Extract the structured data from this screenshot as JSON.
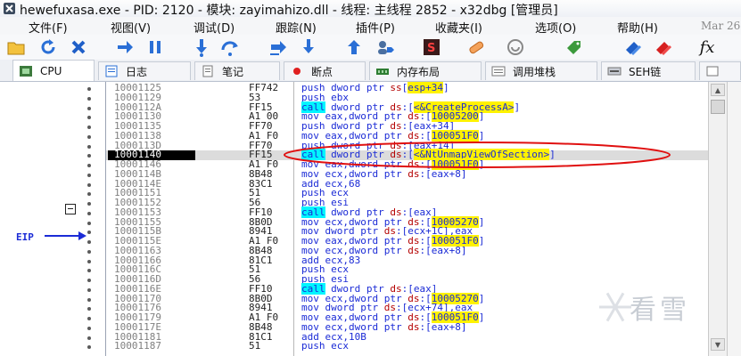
{
  "window": {
    "title": "hewefuxasa.exe - PID: 2120 - 模块: zayimahizo.dll - 线程: 主线程 2852 - x32dbg [管理员]"
  },
  "menu": [
    {
      "label": "文件(F)"
    },
    {
      "label": "视图(V)"
    },
    {
      "label": "调试(D)"
    },
    {
      "label": "跟踪(N)"
    },
    {
      "label": "插件(P)"
    },
    {
      "label": "收藏夹(I)"
    },
    {
      "label": "选项(O)"
    },
    {
      "label": "帮助(H)"
    }
  ],
  "menu_date": "Mar 26",
  "toolbar": [
    {
      "icon": "open-folder-icon"
    },
    {
      "icon": "restart-icon"
    },
    {
      "icon": "close-icon"
    },
    {
      "icon": "run-icon"
    },
    {
      "icon": "pause-icon"
    },
    {
      "icon": "step-into-icon"
    },
    {
      "icon": "step-over-icon"
    },
    {
      "icon": "trace-into-icon"
    },
    {
      "icon": "trace-over-icon"
    },
    {
      "icon": "execute-till-return-icon"
    },
    {
      "icon": "run-to-user-code-icon"
    },
    {
      "icon": "scylla-icon"
    },
    {
      "icon": "patch-icon"
    },
    {
      "icon": "comments-icon"
    },
    {
      "icon": "labels-icon"
    },
    {
      "icon": "bookmarks-icon"
    },
    {
      "icon": "functions-icon"
    }
  ],
  "toolbar_fx": "fx",
  "tabs": [
    {
      "label": "CPU",
      "active": true
    },
    {
      "label": "日志"
    },
    {
      "label": "笔记"
    },
    {
      "label": "断点"
    },
    {
      "label": "内存布局"
    },
    {
      "label": "调用堆栈"
    },
    {
      "label": "SEH链"
    }
  ],
  "eip_label": "EIP",
  "disasm": [
    {
      "addr": "10001125",
      "bytes": "FF742",
      "mn": "push",
      "op": [
        [
          "dword ptr ",
          ""
        ],
        [
          "ss",
          ":seg"
        ],
        [
          "[",
          ""
        ],
        [
          "esp+34",
          "hl"
        ],
        [
          "]",
          ""
        ]
      ]
    },
    {
      "addr": "10001129",
      "bytes": "53",
      "mn": "push",
      "op": [
        [
          "ebx",
          ""
        ]
      ]
    },
    {
      "addr": "1000112A",
      "bytes": "FF15",
      "mn": "call",
      "call": true,
      "op": [
        [
          "dword ptr ",
          ""
        ],
        [
          "ds",
          ":seg"
        ],
        [
          ":[",
          ""
        ],
        [
          "<&CreateProcessA>",
          "hl"
        ],
        [
          "]",
          ""
        ]
      ]
    },
    {
      "addr": "10001130",
      "bytes": "A1 00",
      "mn": "mov",
      "op": [
        [
          "eax,dword ptr ",
          ""
        ],
        [
          "ds",
          ":seg"
        ],
        [
          ":[",
          ""
        ],
        [
          "10005200",
          "hl"
        ],
        [
          "]",
          ""
        ]
      ]
    },
    {
      "addr": "10001135",
      "bytes": "FF70",
      "mn": "push",
      "op": [
        [
          "dword ptr ",
          ""
        ],
        [
          "ds",
          ":seg"
        ],
        [
          ":[eax+34]",
          ""
        ]
      ]
    },
    {
      "addr": "10001138",
      "bytes": "A1 F0",
      "mn": "mov",
      "op": [
        [
          "eax,dword ptr ",
          ""
        ],
        [
          "ds",
          ":seg"
        ],
        [
          ":[",
          ""
        ],
        [
          "100051F0",
          "hl"
        ],
        [
          "]",
          ""
        ]
      ]
    },
    {
      "addr": "1000113D",
      "bytes": "FF70",
      "mn": "push",
      "op": [
        [
          "dword ptr ",
          ""
        ],
        [
          "ds",
          ":seg"
        ],
        [
          ":[eax+14]",
          ""
        ]
      ]
    },
    {
      "addr": "10001140",
      "bytes": "FF15",
      "mn": "call",
      "call": true,
      "sel": true,
      "op": [
        [
          "dword ptr ",
          ""
        ],
        [
          "ds",
          ":seg"
        ],
        [
          ":[",
          ""
        ],
        [
          "<&NtUnmapViewOfSection>",
          "hl"
        ],
        [
          "]",
          ""
        ]
      ]
    },
    {
      "addr": "10001146",
      "bytes": "A1 F0",
      "mn": "mov",
      "op": [
        [
          "eax,dword ptr ",
          ""
        ],
        [
          "ds",
          ":seg"
        ],
        [
          ":[",
          ""
        ],
        [
          "100051F0",
          "hl"
        ],
        [
          "]",
          ""
        ]
      ]
    },
    {
      "addr": "1000114B",
      "bytes": "8B48",
      "mn": "mov",
      "op": [
        [
          "ecx,dword ptr ",
          ""
        ],
        [
          "ds",
          ":seg"
        ],
        [
          ":[eax+8]",
          ""
        ]
      ]
    },
    {
      "addr": "1000114E",
      "bytes": "83C1",
      "mn": "add",
      "op": [
        [
          "ecx,",
          ""
        ],
        [
          "68",
          "num"
        ]
      ]
    },
    {
      "addr": "10001151",
      "bytes": "51",
      "mn": "push",
      "op": [
        [
          "ecx",
          ""
        ]
      ]
    },
    {
      "addr": "10001152",
      "bytes": "56",
      "mn": "push",
      "op": [
        [
          "esi",
          ""
        ]
      ]
    },
    {
      "addr": "10001153",
      "bytes": "FF10",
      "mn": "call",
      "call": true,
      "op": [
        [
          "dword ptr ",
          ""
        ],
        [
          "ds",
          ":seg"
        ],
        [
          ":[eax]",
          ""
        ]
      ]
    },
    {
      "addr": "10001155",
      "bytes": "8B0D",
      "mn": "mov",
      "op": [
        [
          "ecx,dword ptr ",
          ""
        ],
        [
          "ds",
          ":seg"
        ],
        [
          ":[",
          ""
        ],
        [
          "10005270",
          "hl"
        ],
        [
          "]",
          ""
        ]
      ]
    },
    {
      "addr": "1000115B",
      "bytes": "8941",
      "mn": "mov",
      "op": [
        [
          "dword ptr ",
          ""
        ],
        [
          "ds",
          ":seg"
        ],
        [
          ":[ecx+1C],eax",
          ""
        ]
      ]
    },
    {
      "addr": "1000115E",
      "bytes": "A1 F0",
      "mn": "mov",
      "op": [
        [
          "eax,dword ptr ",
          ""
        ],
        [
          "ds",
          ":seg"
        ],
        [
          ":[",
          ""
        ],
        [
          "100051F0",
          "hl"
        ],
        [
          "]",
          ""
        ]
      ]
    },
    {
      "addr": "10001163",
      "bytes": "8B48",
      "mn": "mov",
      "op": [
        [
          "ecx,dword ptr ",
          ""
        ],
        [
          "ds",
          ":seg"
        ],
        [
          ":[eax+8]",
          ""
        ]
      ]
    },
    {
      "addr": "10001166",
      "bytes": "81C1",
      "mn": "add",
      "op": [
        [
          "ecx,",
          ""
        ],
        [
          "83",
          "num"
        ]
      ]
    },
    {
      "addr": "1000116C",
      "bytes": "51",
      "mn": "push",
      "op": [
        [
          "ecx",
          ""
        ]
      ]
    },
    {
      "addr": "1000116D",
      "bytes": "56",
      "mn": "push",
      "op": [
        [
          "esi",
          ""
        ]
      ]
    },
    {
      "addr": "1000116E",
      "bytes": "FF10",
      "mn": "call",
      "call": true,
      "op": [
        [
          "dword ptr ",
          ""
        ],
        [
          "ds",
          ":seg"
        ],
        [
          ":[eax]",
          ""
        ]
      ]
    },
    {
      "addr": "10001170",
      "bytes": "8B0D",
      "mn": "mov",
      "op": [
        [
          "ecx,dword ptr ",
          ""
        ],
        [
          "ds",
          ":seg"
        ],
        [
          ":[",
          ""
        ],
        [
          "10005270",
          "hl"
        ],
        [
          "]",
          ""
        ]
      ]
    },
    {
      "addr": "10001176",
      "bytes": "8941",
      "mn": "mov",
      "op": [
        [
          "dword ptr ",
          ""
        ],
        [
          "ds",
          ":seg"
        ],
        [
          ":[ecx+74],eax",
          ""
        ]
      ]
    },
    {
      "addr": "10001179",
      "bytes": "A1 F0",
      "mn": "mov",
      "op": [
        [
          "eax,dword ptr ",
          ""
        ],
        [
          "ds",
          ":seg"
        ],
        [
          ":[",
          ""
        ],
        [
          "100051F0",
          "hl"
        ],
        [
          "]",
          ""
        ]
      ]
    },
    {
      "addr": "1000117E",
      "bytes": "8B48",
      "mn": "mov",
      "op": [
        [
          "ecx,dword ptr ",
          ""
        ],
        [
          "ds",
          ":seg"
        ],
        [
          ":[eax+8]",
          ""
        ]
      ]
    },
    {
      "addr": "10001181",
      "bytes": "81C1",
      "mn": "add",
      "op": [
        [
          "ecx,",
          ""
        ],
        [
          "10B",
          "num"
        ]
      ]
    },
    {
      "addr": "10001187",
      "bytes": "51",
      "mn": "push",
      "op": [
        [
          "ecx",
          ""
        ]
      ]
    }
  ],
  "watermark": "看雪",
  "colors": {
    "call_bg": "#00f5ff",
    "highlight": "#fff200",
    "annotation": "#e01010",
    "eip": "#1b2bd6"
  }
}
